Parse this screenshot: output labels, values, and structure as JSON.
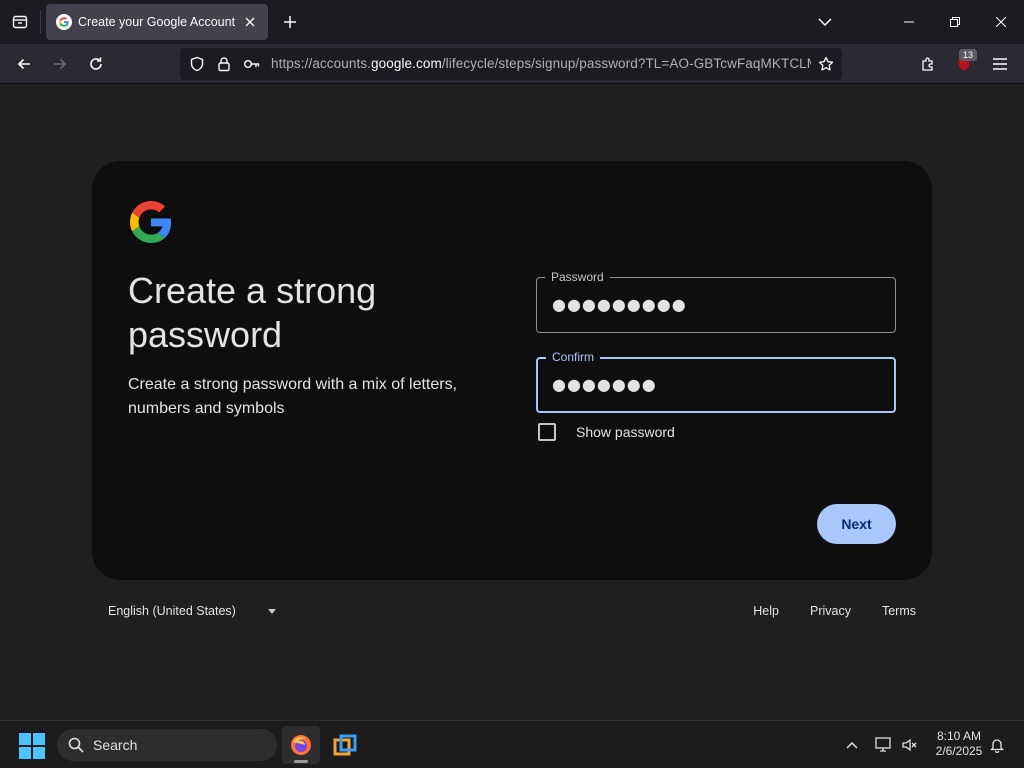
{
  "browser": {
    "tab_title": "Create your Google Account",
    "url_prefix": "https://accounts.",
    "url_host": "google.com",
    "url_suffix": "/lifecycle/steps/signup/password?TL=AO-GBTcwFaqMKTCLM",
    "extension_badge": "13"
  },
  "card": {
    "headline": "Create a strong password",
    "subtext": "Create a strong password with a mix of letters, numbers and symbols",
    "password_label": "Password",
    "password_value": "●●●●●●●●●",
    "confirm_label": "Confirm",
    "confirm_value": "●●●●●●●",
    "show_password_label": "Show password",
    "next_label": "Next"
  },
  "footer": {
    "language": "English (United States)",
    "links": [
      "Help",
      "Privacy",
      "Terms"
    ]
  },
  "taskbar": {
    "search_label": "Search",
    "time": "8:10 AM",
    "date": "2/6/2025"
  },
  "colors": {
    "accent": "#a8c7fa",
    "card_bg": "#0e0e0e",
    "page_bg": "#1f1f1f"
  }
}
